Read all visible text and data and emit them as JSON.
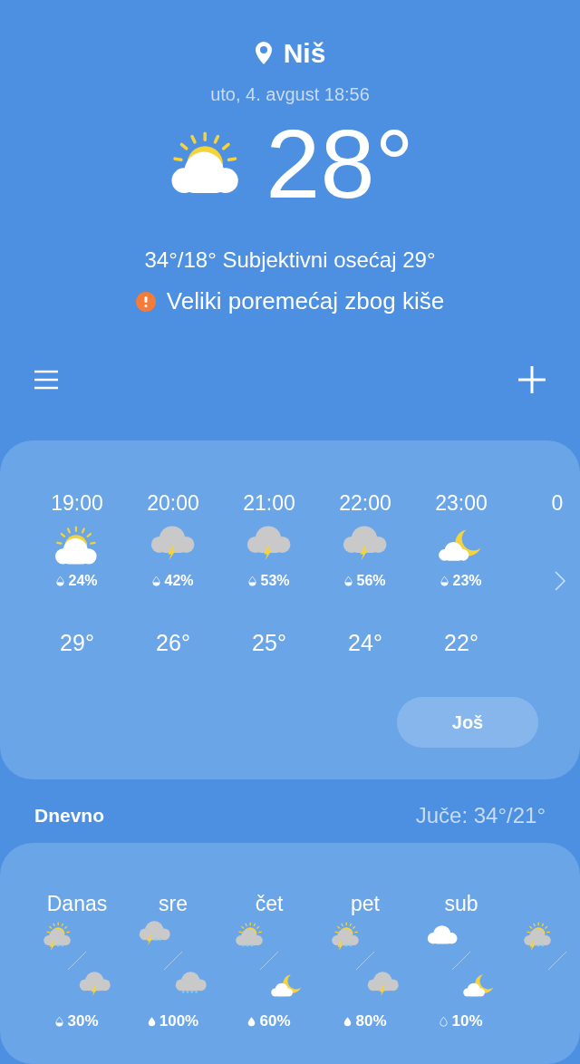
{
  "location": "Niš",
  "datetime": "uto, 4. avgust 18:56",
  "current": {
    "kind": "partly_sunny",
    "temperature": "28°",
    "high_low_feel": "34°/18° Subjektivni osećaj 29°",
    "alert": "Veliki poremećaj zbog kiše"
  },
  "hourly": [
    {
      "time": "19:00",
      "kind": "partly_sunny",
      "rain_chance": {
        "kind": "half",
        "value": "24%"
      },
      "temp": "29°"
    },
    {
      "time": "20:00",
      "kind": "storm",
      "rain_chance": {
        "kind": "half",
        "value": "42%"
      },
      "temp": "26°"
    },
    {
      "time": "21:00",
      "kind": "storm",
      "rain_chance": {
        "kind": "half",
        "value": "53%"
      },
      "temp": "25°"
    },
    {
      "time": "22:00",
      "kind": "storm",
      "rain_chance": {
        "kind": "half",
        "value": "56%"
      },
      "temp": "24°"
    },
    {
      "time": "23:00",
      "kind": "night_cloudy",
      "rain_chance": {
        "kind": "half",
        "value": "23%"
      },
      "temp": "22°"
    },
    {
      "time": "0"
    }
  ],
  "more_button": "Još",
  "daily_title": "Dnevno",
  "yesterday": "Juče: 34°/21°",
  "daily": [
    {
      "day": "Danas",
      "weather": [
        {
          "kind": "sun_storm_rain"
        },
        {
          "kind": "storm"
        }
      ],
      "rain_chance": {
        "kind": "half",
        "value": "30%"
      }
    },
    {
      "day": "sre",
      "weather": [
        {
          "kind": "storm_rain"
        },
        {
          "kind": "rain"
        }
      ],
      "rain_chance": {
        "kind": "full",
        "value": "100%"
      }
    },
    {
      "day": "čet",
      "weather": [
        {
          "kind": "sun_rain"
        },
        {
          "kind": "night_cloudy"
        }
      ],
      "rain_chance": {
        "kind": "full",
        "value": "60%"
      }
    },
    {
      "day": "pet",
      "weather": [
        {
          "kind": "sun_storm_rain"
        },
        {
          "kind": "storm"
        }
      ],
      "rain_chance": {
        "kind": "full",
        "value": "80%"
      }
    },
    {
      "day": "sub",
      "weather": [
        {
          "kind": "cloud"
        },
        {
          "kind": "night_cloudy"
        }
      ],
      "rain_chance": {
        "kind": "empty",
        "value": "10%"
      }
    },
    {
      "weather": [
        {
          "kind": "sun_storm_rain"
        }
      ]
    }
  ]
}
